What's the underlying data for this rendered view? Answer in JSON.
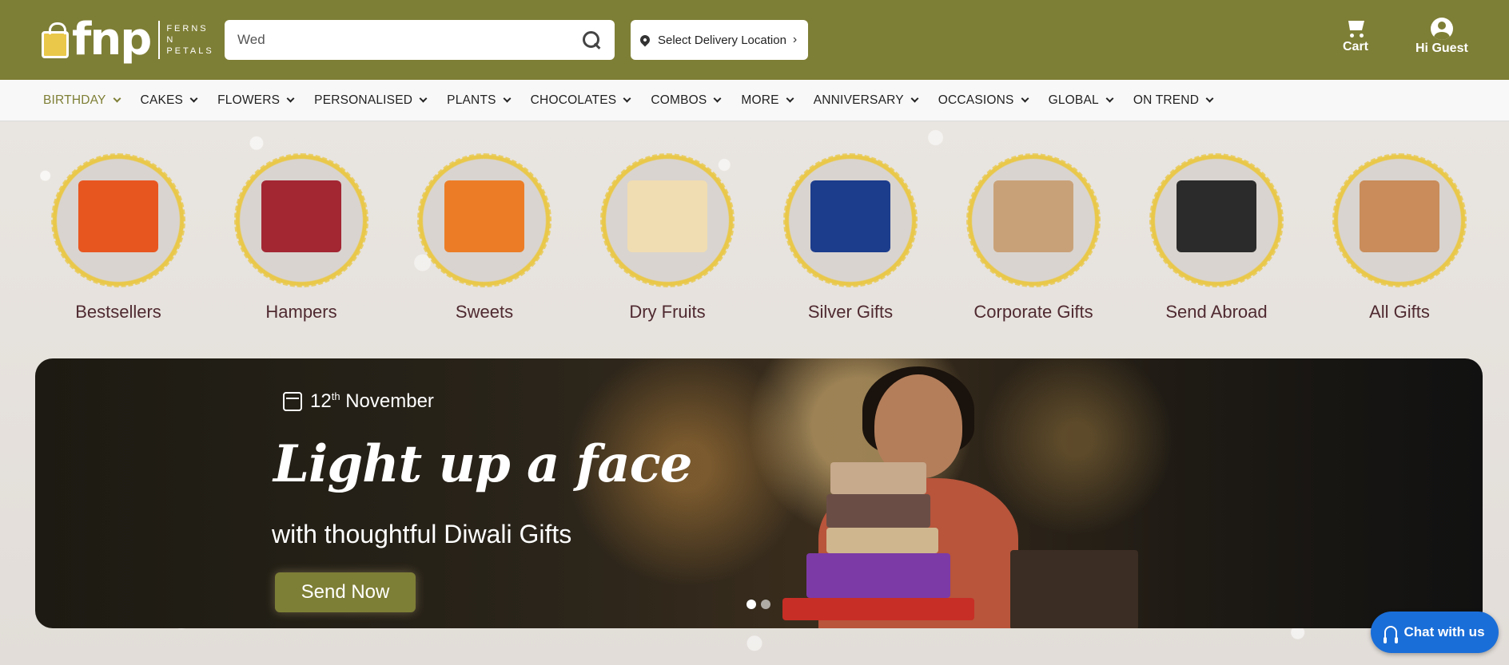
{
  "brand": {
    "logo_text": "fnp",
    "tagline": [
      "FERNS",
      "N",
      "PETALS"
    ]
  },
  "header": {
    "search_value": "Wed",
    "location_label": "Select Delivery Location",
    "cart_label": "Cart",
    "account_label": "Hi Guest"
  },
  "nav": {
    "items": [
      {
        "label": "BIRTHDAY",
        "active": true
      },
      {
        "label": "CAKES"
      },
      {
        "label": "FLOWERS"
      },
      {
        "label": "PERSONALISED"
      },
      {
        "label": "PLANTS"
      },
      {
        "label": "CHOCOLATES"
      },
      {
        "label": "COMBOS"
      },
      {
        "label": "MORE"
      },
      {
        "label": "ANNIVERSARY"
      },
      {
        "label": "OCCASIONS"
      },
      {
        "label": "GLOBAL"
      },
      {
        "label": "ON TREND"
      }
    ]
  },
  "categories": [
    {
      "label": "Bestsellers",
      "icon": "bestsellers-icon"
    },
    {
      "label": "Hampers",
      "icon": "hampers-icon"
    },
    {
      "label": "Sweets",
      "icon": "sweets-icon"
    },
    {
      "label": "Dry Fruits",
      "icon": "dry-fruits-icon"
    },
    {
      "label": "Silver Gifts",
      "icon": "silver-gifts-icon"
    },
    {
      "label": "Corporate Gifts",
      "icon": "corporate-gifts-icon"
    },
    {
      "label": "Send Abroad",
      "icon": "send-abroad-icon"
    },
    {
      "label": "All Gifts",
      "icon": "all-gifts-icon"
    }
  ],
  "banner": {
    "date_day": "12",
    "date_suffix": "th",
    "date_month": "November",
    "headline": "Light up a face",
    "subline": "with thoughtful Diwali Gifts",
    "cta_label": "Send Now",
    "slides_total": 2,
    "active_slide": 1
  },
  "chat": {
    "label": "Chat with us"
  },
  "colors": {
    "brand_olive": "#7e7f36",
    "category_text": "#4f2a30",
    "chat_blue": "#1a6ed8"
  }
}
